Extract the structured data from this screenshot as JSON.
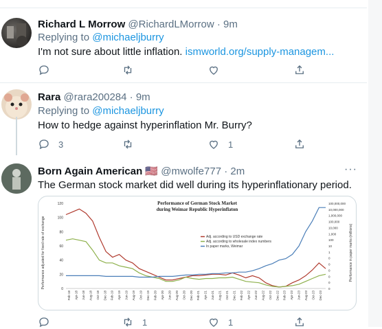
{
  "tweets": [
    {
      "name": "Richard L Morrow",
      "handle": "@RichardLMorrow",
      "time": "· 9m",
      "replying_prefix": "Replying to ",
      "replying_to": "@michaeljburry",
      "text": "I'm not sure about little inflation. ",
      "link": "ismworld.org/supply-managem...",
      "reply_count": "",
      "retweet_count": "",
      "like_count": ""
    },
    {
      "name": "Rara",
      "handle": "@rara200284",
      "time": "· 9m",
      "replying_prefix": "Replying to ",
      "replying_to": "@michaeljburry",
      "text": "How to hedge against hyperinflation Mr. Burry?",
      "reply_count": "3",
      "retweet_count": "",
      "like_count": "1"
    },
    {
      "name": "Born Again American",
      "flag": "🇺🇸",
      "handle": "@mwolfe777",
      "time": "· 2m",
      "text": "The German stock market did well during its hyperinflationary period.",
      "reply_count": "",
      "retweet_count": "1",
      "like_count": "1",
      "more": "···"
    }
  ],
  "icons": [
    "reply-icon",
    "retweet-icon",
    "like-icon",
    "share-icon"
  ],
  "colors": {
    "accent": "#1b95e0",
    "muted": "#5b7083",
    "text": "#0f1419",
    "divider": "#e6ecf0"
  },
  "chart_data": {
    "type": "line",
    "title": "Performance of German Stock Market",
    "subtitle": "during Weimar Republic Hyperinflaton",
    "ylabel_left": "Performance adjusted for fixed rate of exchange",
    "ylabel_right": "Performance in paper marks (millions)",
    "ylim_left": [
      0,
      120
    ],
    "yticks_left": [
      "120",
      "100",
      "80",
      "60",
      "40",
      "20",
      "0"
    ],
    "yticks_right": [
      "100,000,000",
      "10,000,000",
      "1,000,000",
      "100,000",
      "10,000",
      "1,000",
      "100",
      "10",
      "1",
      "0",
      "0",
      "0",
      "0",
      "0",
      "0"
    ],
    "x": [
      "Feb-18",
      "Apr-18",
      "Jun-18",
      "Aug-18",
      "Oct-18",
      "Dec-18",
      "Feb-19",
      "Apr-19",
      "Jun-19",
      "Aug-19",
      "Oct-19",
      "Dec-19",
      "Feb-20",
      "Apr-20",
      "Jun-20",
      "Aug-20",
      "Oct-20",
      "Dec-20",
      "Feb-21",
      "Apr-21",
      "Jun-21",
      "Aug-21",
      "Oct-21",
      "Dec-21",
      "Feb-22",
      "Apr-22",
      "Jun-22",
      "Aug-22",
      "Oct-22",
      "Dec-22",
      "Feb-23",
      "Apr-23",
      "Jun-23",
      "Aug-23",
      "Oct-23",
      "Dec-23"
    ],
    "legend": [
      "Adj. according to USD exchange rate",
      "Adj. according to wholesale index numbers",
      "In paper marks, Weimar"
    ],
    "series": [
      {
        "name": "Adj. according to USD exchange rate",
        "color": "#b03a2e",
        "values": [
          104,
          108,
          112,
          106,
          95,
          72,
          52,
          44,
          48,
          40,
          36,
          28,
          24,
          20,
          16,
          12,
          12,
          14,
          16,
          18,
          18,
          19,
          20,
          20,
          19,
          22,
          19,
          15,
          18,
          15,
          8,
          4,
          2,
          3,
          8,
          12,
          18,
          26,
          36,
          28
        ]
      },
      {
        "name": "Adj. according to wholesale index numbers",
        "color": "#8db04b",
        "values": [
          68,
          70,
          68,
          66,
          54,
          40,
          36,
          36,
          32,
          30,
          28,
          22,
          18,
          16,
          14,
          10,
          10,
          12,
          16,
          14,
          13,
          14,
          14,
          15,
          15,
          16,
          13,
          10,
          9,
          8,
          5,
          3,
          2,
          3,
          4,
          6,
          10,
          14,
          18,
          20
        ]
      },
      {
        "name": "In paper marks, Weimar",
        "color": "#4a7eb8",
        "values": [
          18,
          18,
          18,
          18,
          18,
          18,
          17,
          17,
          17,
          17,
          17,
          16,
          16,
          16,
          17,
          17,
          17,
          18,
          19,
          19,
          20,
          20,
          21,
          21,
          22,
          22,
          23,
          23,
          25,
          28,
          32,
          35,
          40,
          42,
          48,
          60,
          80,
          95,
          114,
          114
        ]
      }
    ]
  }
}
